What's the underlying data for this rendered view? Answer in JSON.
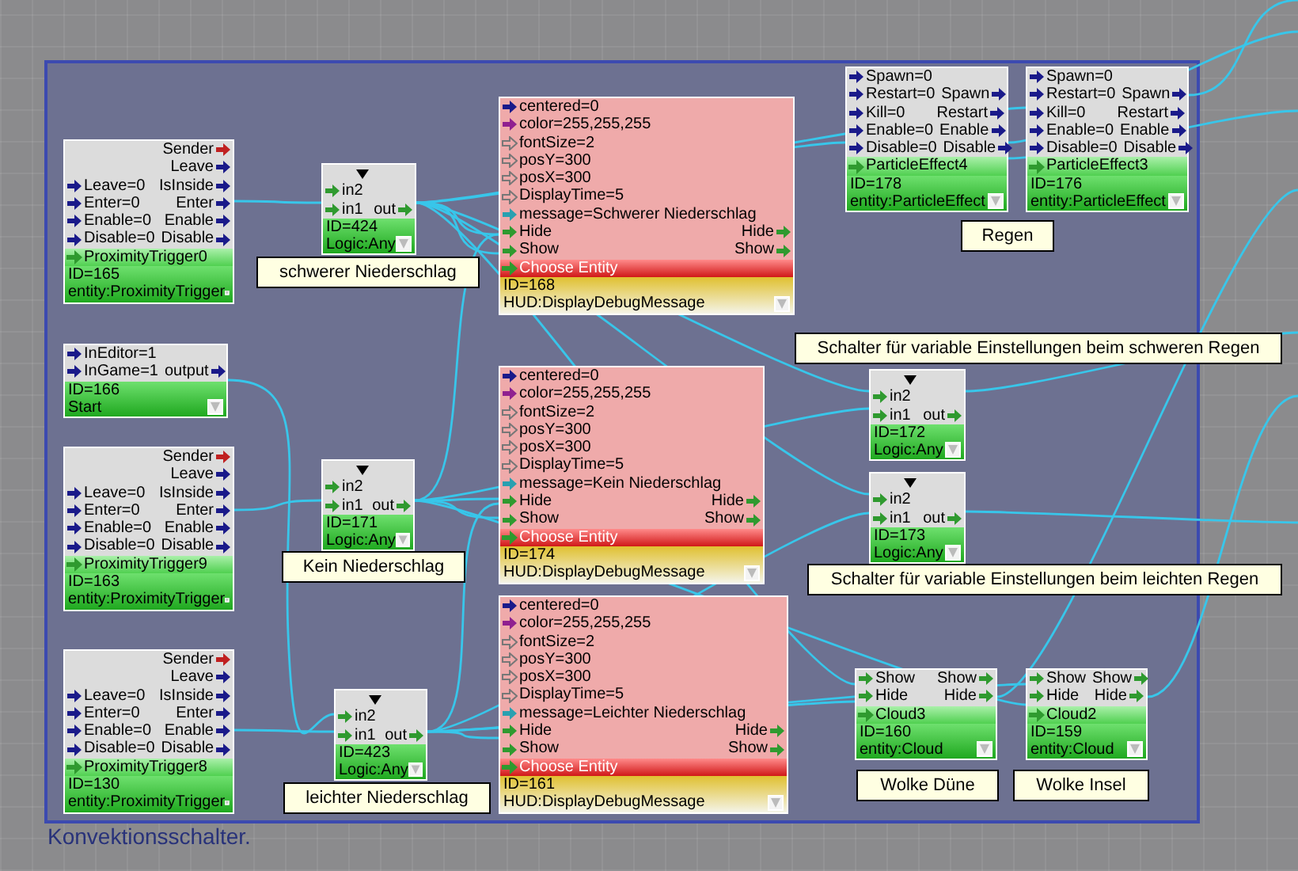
{
  "nodes": [
    {
      "kind": "entity",
      "ports": [
        {
          "kind": "entity",
          "out": "Sender"
        },
        {
          "kind": "bool",
          "out": "Leave"
        },
        {
          "kind": "bool",
          "in": "Leave=0",
          "out": "IsInside"
        },
        {
          "kind": "bool",
          "in": "Enter=0",
          "out": "Enter"
        },
        {
          "kind": "bool",
          "in": "Enable=0",
          "out": "Enable"
        },
        {
          "kind": "bool",
          "in": "Disable=0",
          "out": "Disable"
        }
      ],
      "entity": "ProximityTrigger0",
      "id": "ID=165",
      "type": "entity:ProximityTrigger"
    },
    {
      "kind": "logic",
      "ports": [
        {
          "kind": "event",
          "in": "in2"
        },
        {
          "kind": "event",
          "in": "in1",
          "out": "out"
        }
      ],
      "id": "ID=424",
      "type": "Logic:Any"
    },
    {
      "kind": "start",
      "ports": [
        {
          "kind": "bool",
          "in": "InEditor=1"
        },
        {
          "kind": "bool",
          "in": "InGame=1",
          "out": "output"
        }
      ],
      "id": "ID=166",
      "type": "Start"
    },
    {
      "kind": "entity",
      "ports": [
        {
          "kind": "entity",
          "out": "Sender"
        },
        {
          "kind": "bool",
          "out": "Leave"
        },
        {
          "kind": "bool",
          "in": "Leave=0",
          "out": "IsInside"
        },
        {
          "kind": "bool",
          "in": "Enter=0",
          "out": "Enter"
        },
        {
          "kind": "bool",
          "in": "Enable=0",
          "out": "Enable"
        },
        {
          "kind": "bool",
          "in": "Disable=0",
          "out": "Disable"
        }
      ],
      "entity": "ProximityTrigger9",
      "id": "ID=163",
      "type": "entity:ProximityTrigger"
    },
    {
      "kind": "logic",
      "ports": [
        {
          "kind": "event",
          "in": "in2"
        },
        {
          "kind": "event",
          "in": "in1",
          "out": "out"
        }
      ],
      "id": "ID=171",
      "type": "Logic:Any"
    },
    {
      "kind": "entity",
      "ports": [
        {
          "kind": "entity",
          "out": "Sender"
        },
        {
          "kind": "bool",
          "out": "Leave"
        },
        {
          "kind": "bool",
          "in": "Leave=0",
          "out": "IsInside"
        },
        {
          "kind": "bool",
          "in": "Enter=0",
          "out": "Enter"
        },
        {
          "kind": "bool",
          "in": "Enable=0",
          "out": "Enable"
        },
        {
          "kind": "bool",
          "in": "Disable=0",
          "out": "Disable"
        }
      ],
      "entity": "ProximityTrigger8",
      "id": "ID=130",
      "type": "entity:ProximityTrigger"
    },
    {
      "kind": "logic",
      "ports": [
        {
          "kind": "event",
          "in": "in2"
        },
        {
          "kind": "event",
          "in": "in1",
          "out": "out"
        }
      ],
      "id": "ID=423",
      "type": "Logic:Any"
    },
    {
      "kind": "hud",
      "ports": [
        {
          "kind": "bool",
          "in": "centered=0"
        },
        {
          "kind": "color",
          "in": "color=255,255,255"
        },
        {
          "kind": "number",
          "in": "fontSize=2"
        },
        {
          "kind": "number",
          "in": "posY=300"
        },
        {
          "kind": "number",
          "in": "posX=300"
        },
        {
          "kind": "number",
          "in": "DisplayTime=5"
        },
        {
          "kind": "string",
          "in": "message=Schwerer Niederschlag"
        },
        {
          "kind": "event",
          "in": "Hide",
          "out": "Hide"
        },
        {
          "kind": "event",
          "in": "Show",
          "out": "Show"
        }
      ],
      "entity": "Choose Entity",
      "id": "ID=168",
      "type": "HUD:DisplayDebugMessage"
    },
    {
      "kind": "hud",
      "ports": [
        {
          "kind": "bool",
          "in": "centered=0"
        },
        {
          "kind": "color",
          "in": "color=255,255,255"
        },
        {
          "kind": "number",
          "in": "fontSize=2"
        },
        {
          "kind": "number",
          "in": "posY=300"
        },
        {
          "kind": "number",
          "in": "posX=300"
        },
        {
          "kind": "number",
          "in": "DisplayTime=5"
        },
        {
          "kind": "string",
          "in": "message=Kein Niederschlag"
        },
        {
          "kind": "event",
          "in": "Hide",
          "out": "Hide"
        },
        {
          "kind": "event",
          "in": "Show",
          "out": "Show"
        }
      ],
      "entity": "Choose Entity",
      "id": "ID=174",
      "type": "HUD:DisplayDebugMessage"
    },
    {
      "kind": "hud",
      "ports": [
        {
          "kind": "bool",
          "in": "centered=0"
        },
        {
          "kind": "color",
          "in": "color=255,255,255"
        },
        {
          "kind": "number",
          "in": "fontSize=2"
        },
        {
          "kind": "number",
          "in": "posY=300"
        },
        {
          "kind": "number",
          "in": "posX=300"
        },
        {
          "kind": "number",
          "in": "DisplayTime=5"
        },
        {
          "kind": "string",
          "in": "message=Leichter Niederschlag"
        },
        {
          "kind": "event",
          "in": "Hide",
          "out": "Hide"
        },
        {
          "kind": "event",
          "in": "Show",
          "out": "Show"
        }
      ],
      "entity": "Choose Entity",
      "id": "ID=161",
      "type": "HUD:DisplayDebugMessage"
    },
    {
      "kind": "entity",
      "ports": [
        {
          "kind": "bool",
          "in": "Spawn=0"
        },
        {
          "kind": "bool",
          "in": "Restart=0",
          "out": "Spawn"
        },
        {
          "kind": "bool",
          "in": "Kill=0",
          "out": "Restart"
        },
        {
          "kind": "bool",
          "in": "Enable=0",
          "out": "Enable"
        },
        {
          "kind": "bool",
          "in": "Disable=0",
          "out": "Disable"
        }
      ],
      "entity": "ParticleEffect4",
      "id": "ID=178",
      "type": "entity:ParticleEffect"
    },
    {
      "kind": "entity",
      "ports": [
        {
          "kind": "bool",
          "in": "Spawn=0"
        },
        {
          "kind": "bool",
          "in": "Restart=0",
          "out": "Spawn"
        },
        {
          "kind": "bool",
          "in": "Kill=0",
          "out": "Restart"
        },
        {
          "kind": "bool",
          "in": "Enable=0",
          "out": "Enable"
        },
        {
          "kind": "bool",
          "in": "Disable=0",
          "out": "Disable"
        }
      ],
      "entity": "ParticleEffect3",
      "id": "ID=176",
      "type": "entity:ParticleEffect"
    },
    {
      "kind": "logic",
      "ports": [
        {
          "kind": "event",
          "in": "in2"
        },
        {
          "kind": "event",
          "in": "in1",
          "out": "out"
        }
      ],
      "id": "ID=172",
      "type": "Logic:Any"
    },
    {
      "kind": "logic",
      "ports": [
        {
          "kind": "event",
          "in": "in2"
        },
        {
          "kind": "event",
          "in": "in1",
          "out": "out"
        }
      ],
      "id": "ID=173",
      "type": "Logic:Any"
    },
    {
      "kind": "entity",
      "ports": [
        {
          "kind": "event",
          "in": "Show",
          "out": "Show"
        },
        {
          "kind": "event",
          "in": "Hide",
          "out": "Hide"
        }
      ],
      "entity": "Cloud3",
      "id": "ID=160",
      "type": "entity:Cloud"
    },
    {
      "kind": "entity",
      "ports": [
        {
          "kind": "event",
          "in": "Show",
          "out": "Show"
        },
        {
          "kind": "event",
          "in": "Hide",
          "out": "Hide"
        }
      ],
      "entity": "Cloud2",
      "id": "ID=159",
      "type": "entity:Cloud"
    }
  ],
  "comments": [
    "schwerer Niederschlag",
    "Kein Niederschlag",
    "leichter Niederschlag",
    "Regen",
    "Schalter für variable Einstellungen beim schweren Regen",
    "Schalter für variable Einstellungen beim leichten Regen",
    "Wolke Düne",
    "Wolke Insel"
  ],
  "group_label": "Konvektionsschalter."
}
